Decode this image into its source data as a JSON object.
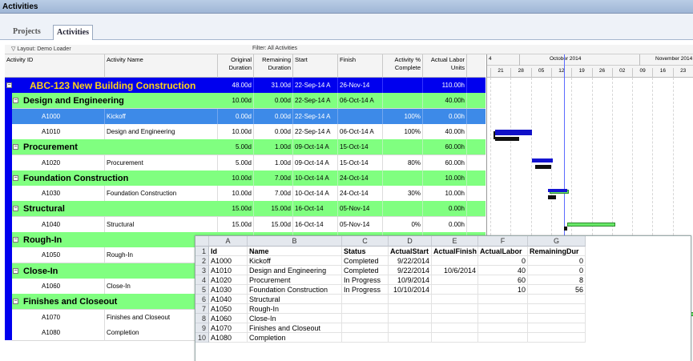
{
  "window": {
    "title": "Activities"
  },
  "tabs": [
    {
      "label": "Projects"
    },
    {
      "label": "Activities"
    }
  ],
  "layout_bar": {
    "layout": "Layout: Demo Loader",
    "filter": "Filter: All Activities"
  },
  "columns": {
    "activity_id": "Activity ID",
    "activity_name": "Activity Name",
    "orig_dur_1": "Original",
    "orig_dur_2": "Duration",
    "rem_dur_1": "Remaining",
    "rem_dur_2": "Duration",
    "start": "Start",
    "finish": "Finish",
    "pct_1": "Activity %",
    "pct_2": "Complete",
    "alu_1": "Actual Labor",
    "alu_2": "Units"
  },
  "rows": [
    {
      "type": "project",
      "title": "ABC-123  New Building Construction",
      "orig": "48.00d",
      "rem": "31.00d",
      "start": "22-Sep-14 A",
      "finish": "26-Nov-14",
      "pct": "",
      "units": "110.00h"
    },
    {
      "type": "wbs",
      "title": "Design and Engineering",
      "orig": "10.00d",
      "rem": "0.00d",
      "start": "22-Sep-14 A",
      "finish": "06-Oct-14 A",
      "pct": "",
      "units": "40.00h"
    },
    {
      "type": "sel",
      "id": "A1000",
      "name": "Kickoff",
      "orig": "0.00d",
      "rem": "0.00d",
      "start": "22-Sep-14 A",
      "finish": "",
      "pct": "100%",
      "units": "0.00h"
    },
    {
      "type": "act",
      "id": "A1010",
      "name": "Design and Engineering",
      "orig": "10.00d",
      "rem": "0.00d",
      "start": "22-Sep-14 A",
      "finish": "06-Oct-14 A",
      "pct": "100%",
      "units": "40.00h"
    },
    {
      "type": "wbs",
      "title": "Procurement",
      "orig": "5.00d",
      "rem": "1.00d",
      "start": "09-Oct-14 A",
      "finish": "15-Oct-14",
      "pct": "",
      "units": "60.00h"
    },
    {
      "type": "act",
      "id": "A1020",
      "name": "Procurement",
      "orig": "5.00d",
      "rem": "1.00d",
      "start": "09-Oct-14 A",
      "finish": "15-Oct-14",
      "pct": "80%",
      "units": "60.00h"
    },
    {
      "type": "wbs",
      "title": "Foundation Construction",
      "orig": "10.00d",
      "rem": "7.00d",
      "start": "10-Oct-14 A",
      "finish": "24-Oct-14",
      "pct": "",
      "units": "10.00h"
    },
    {
      "type": "act",
      "id": "A1030",
      "name": "Foundation Construction",
      "orig": "10.00d",
      "rem": "7.00d",
      "start": "10-Oct-14 A",
      "finish": "24-Oct-14",
      "pct": "30%",
      "units": "10.00h"
    },
    {
      "type": "wbs",
      "title": "Structural",
      "orig": "15.00d",
      "rem": "15.00d",
      "start": "16-Oct-14",
      "finish": "05-Nov-14",
      "pct": "",
      "units": "0.00h"
    },
    {
      "type": "act",
      "id": "A1040",
      "name": "Structural",
      "orig": "15.00d",
      "rem": "15.00d",
      "start": "16-Oct-14",
      "finish": "05-Nov-14",
      "pct": "0%",
      "units": "0.00h"
    },
    {
      "type": "wbs",
      "title": "Rough-In",
      "orig": "",
      "rem": "",
      "start": "",
      "finish": "",
      "pct": "",
      "units": ""
    },
    {
      "type": "act",
      "id": "A1050",
      "name": "Rough-In",
      "orig": "",
      "rem": "",
      "start": "",
      "finish": "",
      "pct": "",
      "units": ""
    },
    {
      "type": "wbs",
      "title": "Close-In",
      "orig": "",
      "rem": "",
      "start": "",
      "finish": "",
      "pct": "",
      "units": ""
    },
    {
      "type": "act",
      "id": "A1060",
      "name": "Close-In",
      "orig": "",
      "rem": "",
      "start": "",
      "finish": "",
      "pct": "",
      "units": ""
    },
    {
      "type": "wbs",
      "title": "Finishes and Closeout",
      "orig": "",
      "rem": "",
      "start": "",
      "finish": "",
      "pct": "",
      "units": ""
    },
    {
      "type": "act",
      "id": "A1070",
      "name": "Finishes and Closeout",
      "orig": "",
      "rem": "",
      "start": "",
      "finish": "",
      "pct": "",
      "units": ""
    },
    {
      "type": "act",
      "id": "A1080",
      "name": "Completion",
      "orig": "",
      "rem": "",
      "start": "",
      "finish": "",
      "pct": "",
      "units": ""
    }
  ],
  "gantt": {
    "months": [
      "October 2014",
      "November 2014"
    ],
    "days": [
      "21",
      "28",
      "05",
      "12",
      "19",
      "26",
      "02",
      "09",
      "16",
      "23"
    ],
    "partial_label": "4"
  },
  "spreadsheet": {
    "col_letters": [
      "A",
      "B",
      "C",
      "D",
      "E",
      "F",
      "G"
    ],
    "headers": [
      "Id",
      "Name",
      "Status",
      "ActualStart",
      "ActualFinish",
      "ActualLabor",
      "RemainingDur"
    ],
    "rows": [
      [
        "A1000",
        "Kickoff",
        "Completed",
        "9/22/2014",
        "",
        "0",
        "0"
      ],
      [
        "A1010",
        "Design and Engineering",
        "Completed",
        "9/22/2014",
        "10/6/2014",
        "40",
        "0"
      ],
      [
        "A1020",
        "Procurement",
        "In Progress",
        "10/9/2014",
        "",
        "60",
        "8"
      ],
      [
        "A1030",
        "Foundation Construction",
        "In Progress",
        "10/10/2014",
        "",
        "10",
        "56"
      ],
      [
        "A1040",
        "Structural",
        "",
        "",
        "",
        "",
        ""
      ],
      [
        "A1050",
        "Rough-In",
        "",
        "",
        "",
        "",
        ""
      ],
      [
        "A1060",
        "Close-In",
        "",
        "",
        "",
        "",
        ""
      ],
      [
        "A1070",
        "Finishes and Closeout",
        "",
        "",
        "",
        "",
        ""
      ],
      [
        "A1080",
        "Completion",
        "",
        "",
        "",
        "",
        ""
      ]
    ],
    "row_numbers": [
      "1",
      "2",
      "3",
      "4",
      "5",
      "6",
      "7",
      "8",
      "9",
      "10"
    ]
  },
  "colors": {
    "project_row": "#0000ee",
    "wbs_row": "#80ff80",
    "selected_row": "#3d8ae8",
    "project_text": "#ffd21a"
  }
}
